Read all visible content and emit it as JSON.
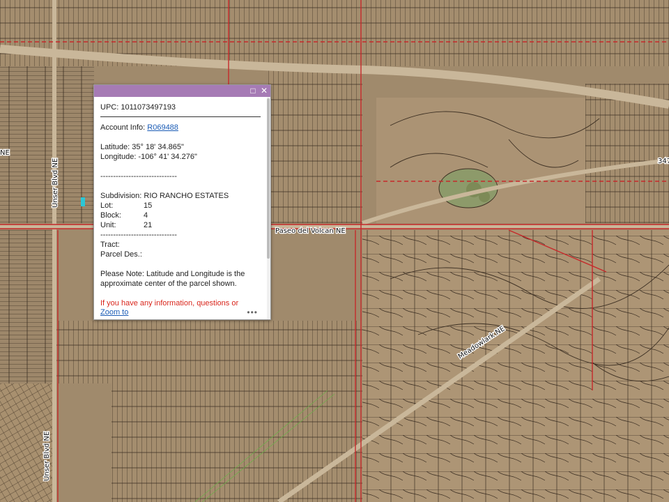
{
  "map": {
    "road_labels": [
      "Paseo del Volcan NE",
      "Unser Blvd NE",
      "Unser Blvd NE",
      "Meadowlark NE",
      "347"
    ],
    "edge_label": "NE",
    "colors": {
      "parcel_line": "#3c2f22",
      "boundary_red": "#c6292a",
      "road": "#c9b79a",
      "ground": "#a08a6c"
    }
  },
  "popup": {
    "upc": "UPC: 1011073497193",
    "account_label": "Account Info: ",
    "account_link": "R069488",
    "latitude": "Latitude: 35° 18' 34.865\"",
    "longitude": "Longitude: -106° 41' 34.276\"",
    "dashes_1": "------------------------------",
    "subdivision": "Subdivision: RIO RANCHO ESTATES",
    "lot_label": "Lot:",
    "lot_value": "15",
    "block_label": "Block:",
    "block_value": "4",
    "unit_label": "Unit:",
    "unit_value": "21",
    "dashes_2": "------------------------------",
    "tract": "Tract:",
    "parcel_des": "Parcel Des.:",
    "note": "Please Note: Latitude and Longitude is the approximate center of the parcel shown.",
    "red_note": "If you have any information, questions or",
    "zoom_link": "Zoom to",
    "maximize_icon": "maximize-icon",
    "close_icon": "close-icon",
    "more_icon": "more-icon",
    "header_color": "#a67bb5"
  }
}
